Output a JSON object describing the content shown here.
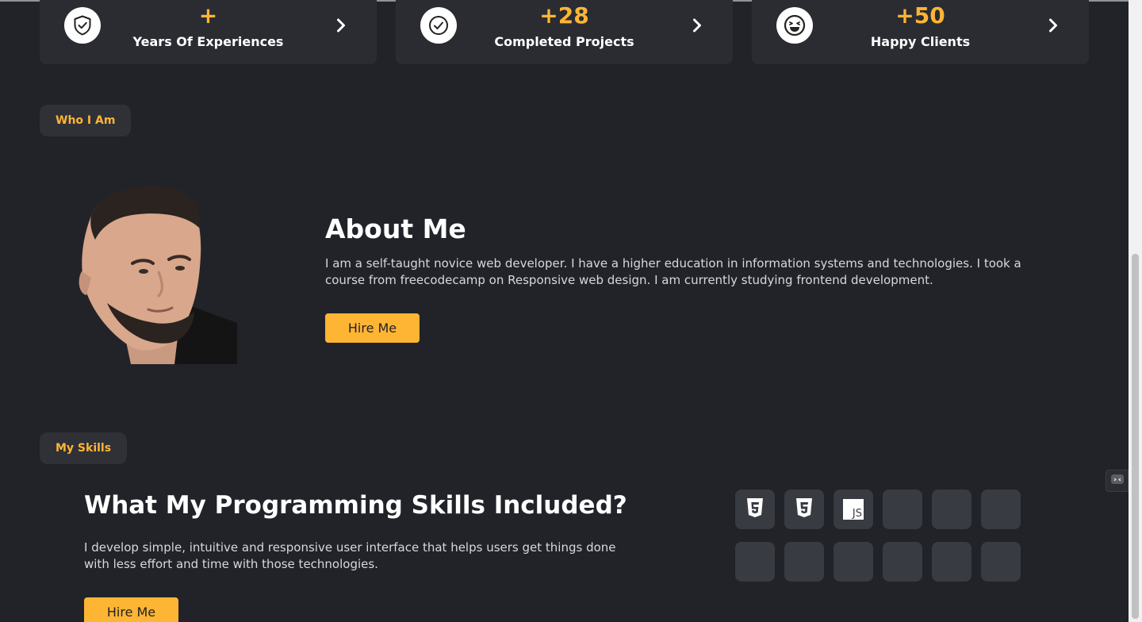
{
  "stats": [
    {
      "value": "+",
      "label": "Years Of Experiences",
      "icon": "shield-check-icon"
    },
    {
      "value": "+28",
      "label": "Completed Projects",
      "icon": "check-circle-icon"
    },
    {
      "value": "+50",
      "label": "Happy Clients",
      "icon": "laughing-face-icon"
    }
  ],
  "about": {
    "tag": "Who I Am",
    "title": "About Me",
    "text": "I am a self-taught novice web developer. I have a higher education in information systems and technologies. I took a course from freecodecamp on Responsive web design. I am currently studying frontend development.",
    "button": "Hire Me"
  },
  "skills": {
    "tag": "My Skills",
    "title": "What My Programming Skills Included?",
    "text": "I develop simple, intuitive and responsive user interface that helps users get things done with less effort and time with those technologies.",
    "button": "Hire Me",
    "tiles": [
      {
        "icon": "html5-icon"
      },
      {
        "icon": "css3-icon"
      },
      {
        "icon": "javascript-icon",
        "label": "JS"
      },
      {
        "icon": ""
      },
      {
        "icon": ""
      },
      {
        "icon": ""
      },
      {
        "icon": ""
      },
      {
        "icon": ""
      },
      {
        "icon": ""
      },
      {
        "icon": ""
      },
      {
        "icon": ""
      },
      {
        "icon": ""
      }
    ]
  },
  "colors": {
    "background": "#212329",
    "card": "#2a2c32",
    "accent": "#ffb534",
    "tile": "#383b42"
  }
}
